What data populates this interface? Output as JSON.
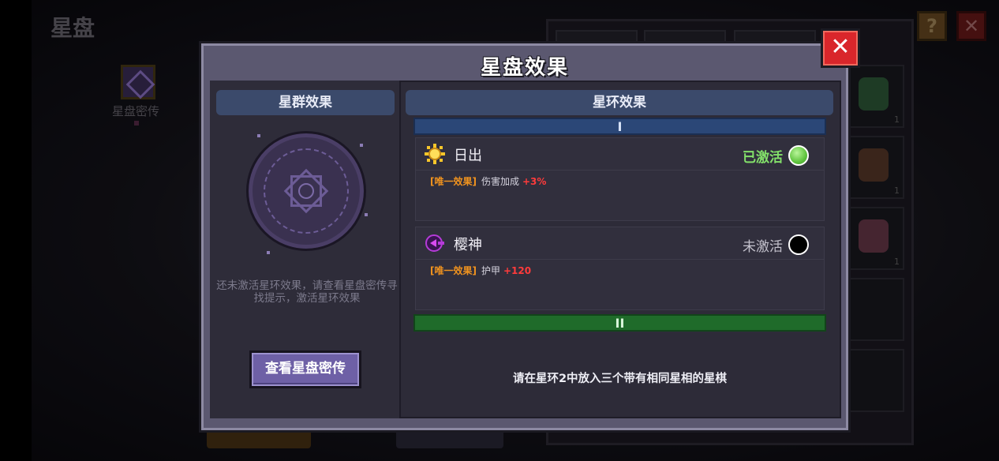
{
  "background": {
    "page_title": "星盘",
    "side_item_label": "星盘密传",
    "help_glyph": "?",
    "close_glyph": "✕",
    "slot_counts": [
      "1",
      "1",
      "1"
    ]
  },
  "modal": {
    "title": "星盘效果",
    "close_glyph": "✕",
    "left": {
      "header": "星群效果",
      "hint": "还未激活星环效果，请查看星盘密传寻找提示，激活星环效果",
      "button_label": "查看星盘密传"
    },
    "right": {
      "header": "星环效果",
      "rings": [
        {
          "numeral": "I",
          "effects": [
            {
              "name": "日出",
              "status": "已激活",
              "active": true,
              "tag": "[唯一效果]",
              "stat": "伤害加成",
              "bonus": "+3%",
              "icon": "sun-icon"
            },
            {
              "name": "樱神",
              "status": "未激活",
              "active": false,
              "tag": "[唯一效果]",
              "stat": "护甲",
              "bonus": "+120",
              "icon": "sakura-spirit-icon"
            }
          ]
        },
        {
          "numeral": "II",
          "message": "请在星环2中放入三个带有相同星相的星棋"
        }
      ]
    }
  },
  "colors": {
    "active_green": "#83e06a",
    "tag_orange": "#f0931f",
    "bonus_red": "#ff3b3b",
    "ring1_blue": "#2b4777",
    "ring2_green": "#1f6b2a",
    "close_red": "#d9262b"
  }
}
